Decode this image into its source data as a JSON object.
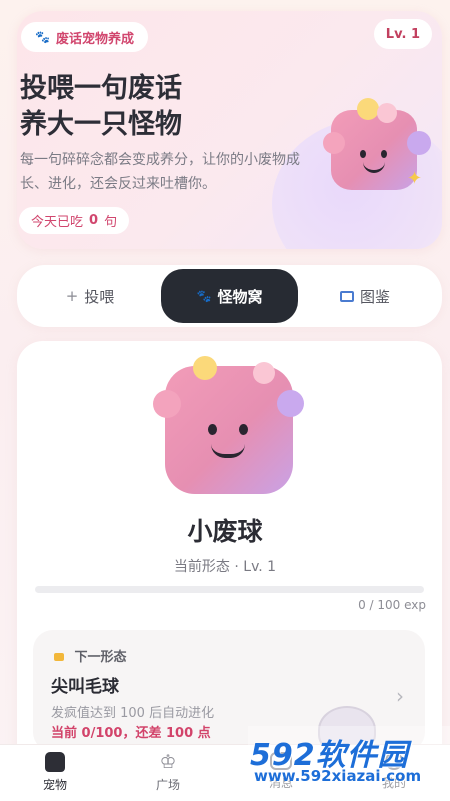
{
  "hero": {
    "tag": "废话宠物养成",
    "level": "Lv. 1",
    "title_line1": "投喂一句废话",
    "title_line2": "养大一只怪物",
    "description": "每一句碎碎念都会变成养分，让你的小废物成长、进化，还会反过来吐槽你。",
    "today_prefix": "今天已吃",
    "today_count": "0",
    "today_suffix": "句"
  },
  "tabs": [
    {
      "label": "投喂",
      "icon": "plus-icon"
    },
    {
      "label": "怪物窝",
      "icon": "paw-icon",
      "active": true
    },
    {
      "label": "图鉴",
      "icon": "book-icon"
    }
  ],
  "monster": {
    "name": "小废球",
    "form": "当前形态 · Lv. 1",
    "exp_text": "0 / 100 exp",
    "exp_progress": 0
  },
  "next_form": {
    "label": "下一形态",
    "icon": "lock-icon",
    "name": "尖叫毛球",
    "condition": "发疯值达到 100 后自动进化",
    "progress": "当前 0/100，还差 100 点"
  },
  "nav": [
    {
      "label": "宠物",
      "icon": "home-icon",
      "active": true
    },
    {
      "label": "广场",
      "icon": "crown-icon"
    },
    {
      "label": "消息",
      "icon": "message-icon"
    },
    {
      "label": "我的",
      "icon": "user-icon"
    }
  ],
  "watermark": {
    "brand": "592软件园",
    "url": "www.592xiazai.com"
  },
  "colors": {
    "accent_pink": "#d1466e",
    "dark": "#272b33",
    "monster_pink": "#ee97b6",
    "monster_purple": "#c9a2e6"
  }
}
